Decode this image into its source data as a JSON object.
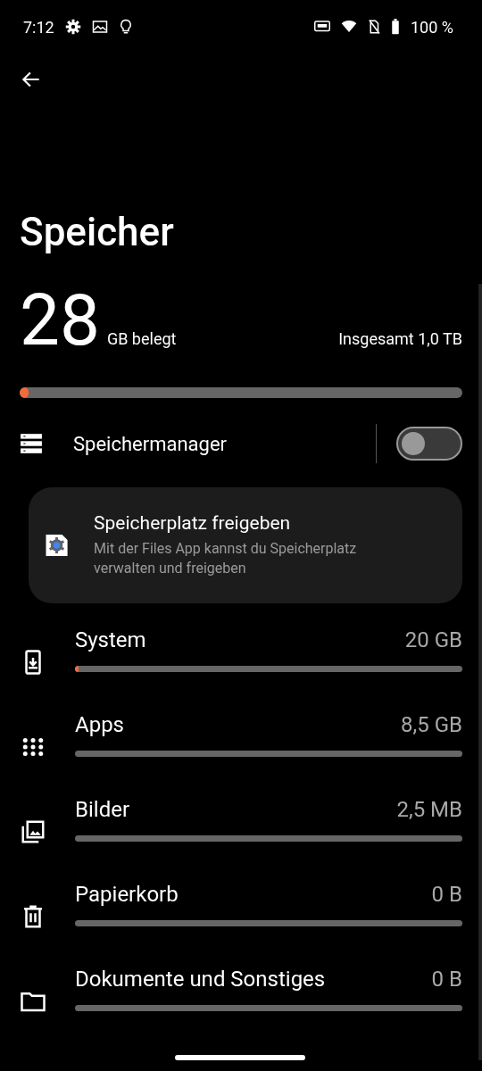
{
  "status_bar": {
    "time": "7:12",
    "battery": "100 %"
  },
  "title": "Speicher",
  "usage": {
    "amount": "28",
    "unit": "GB belegt",
    "total": "Insgesamt 1,0 TB",
    "level": 0.01
  },
  "manager": {
    "label": "Speichermanager",
    "on": false
  },
  "card": {
    "title": "Speicherplatz freigeben",
    "text": "Mit der Files App kannst du Speicherplatz verwalten und freigeben"
  },
  "categories": [
    {
      "kind": "system",
      "name": "System",
      "size": "20 GB",
      "level": 0.005
    },
    {
      "kind": "apps",
      "name": "Apps",
      "size": "8,5 GB"
    },
    {
      "kind": "images",
      "name": "Bilder",
      "size": "2,5 MB"
    },
    {
      "kind": "trash",
      "name": "Papierkorb",
      "size": "0 B"
    },
    {
      "kind": "documents",
      "name": "Dokumente und Sonstiges",
      "size": "0 B"
    }
  ]
}
